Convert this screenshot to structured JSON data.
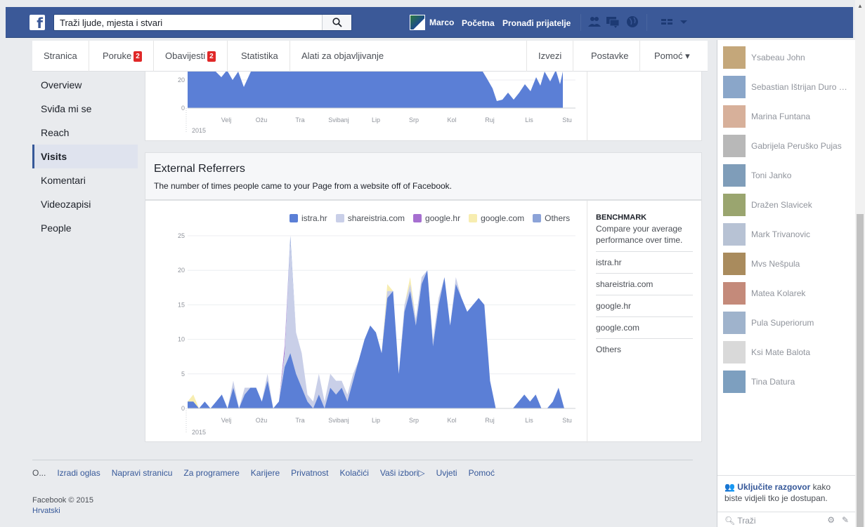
{
  "topbar": {
    "search_placeholder": "Traži ljude, mjesta i stvari",
    "user_name": "Marco",
    "home_label": "Početna",
    "find_friends_label": "Pronađi prijatelje"
  },
  "pagenav": {
    "page": "Stranica",
    "messages": "Poruke",
    "messages_count": "2",
    "notifications": "Obavijesti",
    "notifications_count": "2",
    "insights": "Statistika",
    "publishing_tools": "Alati za objavljivanje",
    "reports": "Izvezi",
    "settings": "Postavke",
    "help": "Pomoć ▾"
  },
  "leftmenu": {
    "items": [
      "Overview",
      "Sviđa mi se",
      "Reach",
      "Visits",
      "Komentari",
      "Videozapisi",
      "People"
    ],
    "active_index": 3
  },
  "top_chart": {
    "y_ticks": [
      "20",
      "0"
    ],
    "x_labels": [
      "Velj",
      "Ožu",
      "Tra",
      "Svibanj",
      "Lip",
      "Srp",
      "Kol",
      "Ruj",
      "Lis",
      "Stu"
    ],
    "year": "2015"
  },
  "referrers": {
    "title": "External Referrers",
    "subtitle": "The number of times people came to your Page from a website off of Facebook.",
    "benchmark_title": "BENCHMARK",
    "benchmark_desc": "Compare your average performance over time.",
    "benchmark_items": [
      "istra.hr",
      "shareistria.com",
      "google.hr",
      "google.com",
      "Others"
    ]
  },
  "chart_data": {
    "type": "area",
    "title": "External Referrers",
    "x_labels": [
      "Velj",
      "Ožu",
      "Tra",
      "Svibanj",
      "Lip",
      "Srp",
      "Kol",
      "Ruj",
      "Lis",
      "Stu"
    ],
    "year_label": "2015",
    "y_ticks": [
      "25",
      "20",
      "15",
      "10",
      "5",
      "0"
    ],
    "ylim": [
      0,
      25
    ],
    "legend_position": "top-right",
    "series_colors": {
      "istra.hr": "#5b7fd6",
      "shareistria.com": "#c9cfe8",
      "google.hr": "#a66fd0",
      "google.com": "#f7edb0",
      "Others": "#8ca3d8"
    },
    "series": [
      {
        "name": "istra.hr",
        "values": [
          1,
          1,
          0,
          1,
          0,
          1,
          2,
          0,
          3,
          0,
          2,
          3,
          3,
          1,
          4,
          0,
          1,
          6,
          8,
          5,
          3,
          1,
          0,
          2,
          0,
          3,
          2,
          3,
          1,
          4,
          7,
          10,
          12,
          11,
          8,
          16,
          17,
          5,
          14,
          17,
          12,
          18,
          20,
          9,
          15,
          19,
          12,
          18,
          16,
          14,
          15,
          16,
          15,
          4,
          0,
          0,
          0,
          0,
          1,
          2,
          1,
          2,
          0,
          0,
          1,
          3,
          0
        ]
      },
      {
        "name": "shareistria.com",
        "values": [
          0,
          0,
          0,
          0,
          0,
          0,
          0,
          0,
          1,
          0,
          1,
          0,
          0,
          0,
          1,
          0,
          0,
          2,
          16,
          6,
          5,
          1,
          1,
          3,
          1,
          2,
          2,
          1,
          1,
          1,
          0,
          0,
          0,
          0,
          0,
          1,
          0,
          0,
          1,
          1,
          1,
          1,
          0,
          1,
          1,
          0,
          0,
          1,
          0,
          0,
          0,
          0,
          0,
          0,
          0,
          0,
          0,
          0,
          0,
          0,
          0,
          0,
          0,
          0,
          0,
          0,
          0
        ]
      },
      {
        "name": "google.hr",
        "values": [
          0,
          0,
          0,
          0,
          0,
          0,
          0,
          0,
          0,
          0,
          0,
          0,
          0,
          0,
          0,
          0,
          0,
          1,
          0,
          0,
          0,
          0,
          0,
          0,
          0,
          0,
          0,
          0,
          0,
          0,
          0,
          0,
          0,
          0,
          0,
          0,
          0,
          0,
          0,
          0,
          0,
          0,
          0,
          0,
          0,
          0,
          0,
          0,
          0,
          0,
          0,
          0,
          0,
          0,
          0,
          0,
          0,
          0,
          0,
          0,
          0,
          0,
          0,
          0,
          0,
          0,
          0
        ]
      },
      {
        "name": "google.com",
        "values": [
          0,
          1,
          0,
          0,
          0,
          0,
          0,
          0,
          0,
          0,
          0,
          0,
          0,
          0,
          0,
          0,
          0,
          0,
          0,
          0,
          0,
          0,
          0,
          0,
          0,
          0,
          0,
          0,
          0,
          0,
          0,
          0,
          0,
          0,
          0,
          1,
          0,
          0,
          0,
          1,
          0,
          0,
          0,
          0,
          0,
          0,
          0,
          0,
          0,
          0,
          0,
          0,
          0,
          0,
          0,
          0,
          0,
          0,
          0,
          0,
          0,
          0,
          0,
          0,
          0,
          0,
          0
        ]
      },
      {
        "name": "Others",
        "values": [
          0,
          0,
          0,
          0,
          0,
          0,
          0,
          0,
          0,
          0,
          0,
          0,
          0,
          0,
          0,
          0,
          0,
          0,
          1,
          0,
          0,
          0,
          0,
          0,
          0,
          0,
          0,
          0,
          0,
          0,
          0,
          0,
          0,
          0,
          0,
          0,
          0,
          0,
          0,
          0,
          0,
          0,
          0,
          0,
          0,
          0,
          0,
          0,
          0,
          0,
          0,
          0,
          0,
          0,
          0,
          0,
          0,
          0,
          0,
          0,
          0,
          0,
          0,
          0,
          0,
          0,
          0
        ]
      }
    ]
  },
  "footer": {
    "links": [
      "O...",
      "Izradi oglas",
      "Napravi stranicu",
      "Za programere",
      "Karijere",
      "Privatnost",
      "Kolačići",
      "Vaši izbori▷",
      "Uvjeti",
      "Pomoć"
    ],
    "copyright": "Facebook © 2015",
    "language": "Hrvatski"
  },
  "chat": {
    "friends": [
      "Ysabeau John",
      "Sebastian Ištrijan Duro D...",
      "Marina Funtana",
      "Gabrijela Peruško Pujas",
      "Toni Janko",
      "Dražen Slavicek",
      "Mark Trivanovic",
      "Mvs Nešpula",
      "Matea Kolarek",
      "Pula Superiorum",
      "Ksi Mate Balota",
      "Tina Datura"
    ],
    "turn_on_link": "Uključite razgovor",
    "turn_on_rest": "kako biste vidjeli tko je dostupan.",
    "search_placeholder": "Traži"
  }
}
